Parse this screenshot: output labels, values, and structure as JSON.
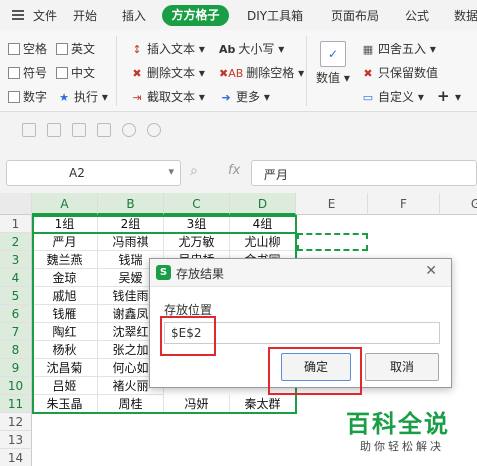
{
  "menu": {
    "file": "文件",
    "tabs": [
      "开始",
      "插入",
      "方方格子",
      "DIY工具箱",
      "页面布局",
      "公式",
      "数据"
    ]
  },
  "ribbon": {
    "checkboxes": [
      "空格",
      "英文",
      "符号",
      "中文",
      "数字"
    ],
    "execute": "执行",
    "insert_text": "插入文本",
    "delete_text": "删除文本",
    "extract_text": "截取文本",
    "case": "大小写",
    "delete_space": "删除空格",
    "more": "更多",
    "numeric": "数值",
    "round": "四舍五入",
    "keep_value": "只保留数值",
    "custom": "自定义"
  },
  "formula_bar": {
    "name_box": "A2",
    "fx": "fx",
    "content": "严月"
  },
  "sheet": {
    "columns": [
      "A",
      "B",
      "C",
      "D",
      "E",
      "F",
      "G"
    ],
    "rows": [
      "1",
      "2",
      "3",
      "4",
      "5",
      "6",
      "7",
      "8",
      "9",
      "10",
      "11",
      "12",
      "13",
      "14"
    ],
    "data": [
      [
        "1组",
        "2组",
        "3组",
        "4组"
      ],
      [
        "严月",
        "冯雨祺",
        "尤万敏",
        "尤山柳"
      ],
      [
        "魏兰燕",
        "钱瑞",
        "吴忠桥",
        "金书同"
      ],
      [
        "金琼",
        "吴嫒",
        "",
        ""
      ],
      [
        "戚旭",
        "钱佳雨",
        "",
        ""
      ],
      [
        "钱雁",
        "谢鑫凤",
        "",
        ""
      ],
      [
        "陶红",
        "沈翠红",
        "",
        ""
      ],
      [
        "杨秋",
        "张之加",
        "",
        ""
      ],
      [
        "沈昌菊",
        "何心如",
        "",
        ""
      ],
      [
        "吕姬",
        "褚火丽",
        "",
        ""
      ],
      [
        "朱玉晶",
        "周桂",
        "冯妍",
        "秦太群"
      ]
    ]
  },
  "dialog": {
    "logo": "S",
    "title": "存放结果",
    "label": "存放位置",
    "value": "$E$2",
    "ok": "确定",
    "cancel": "取消"
  },
  "watermark": {
    "title": "百科全说",
    "subtitle": "助你轻松解决"
  },
  "colors": {
    "accent": "#1a9e45",
    "highlight": "#e0282d"
  }
}
